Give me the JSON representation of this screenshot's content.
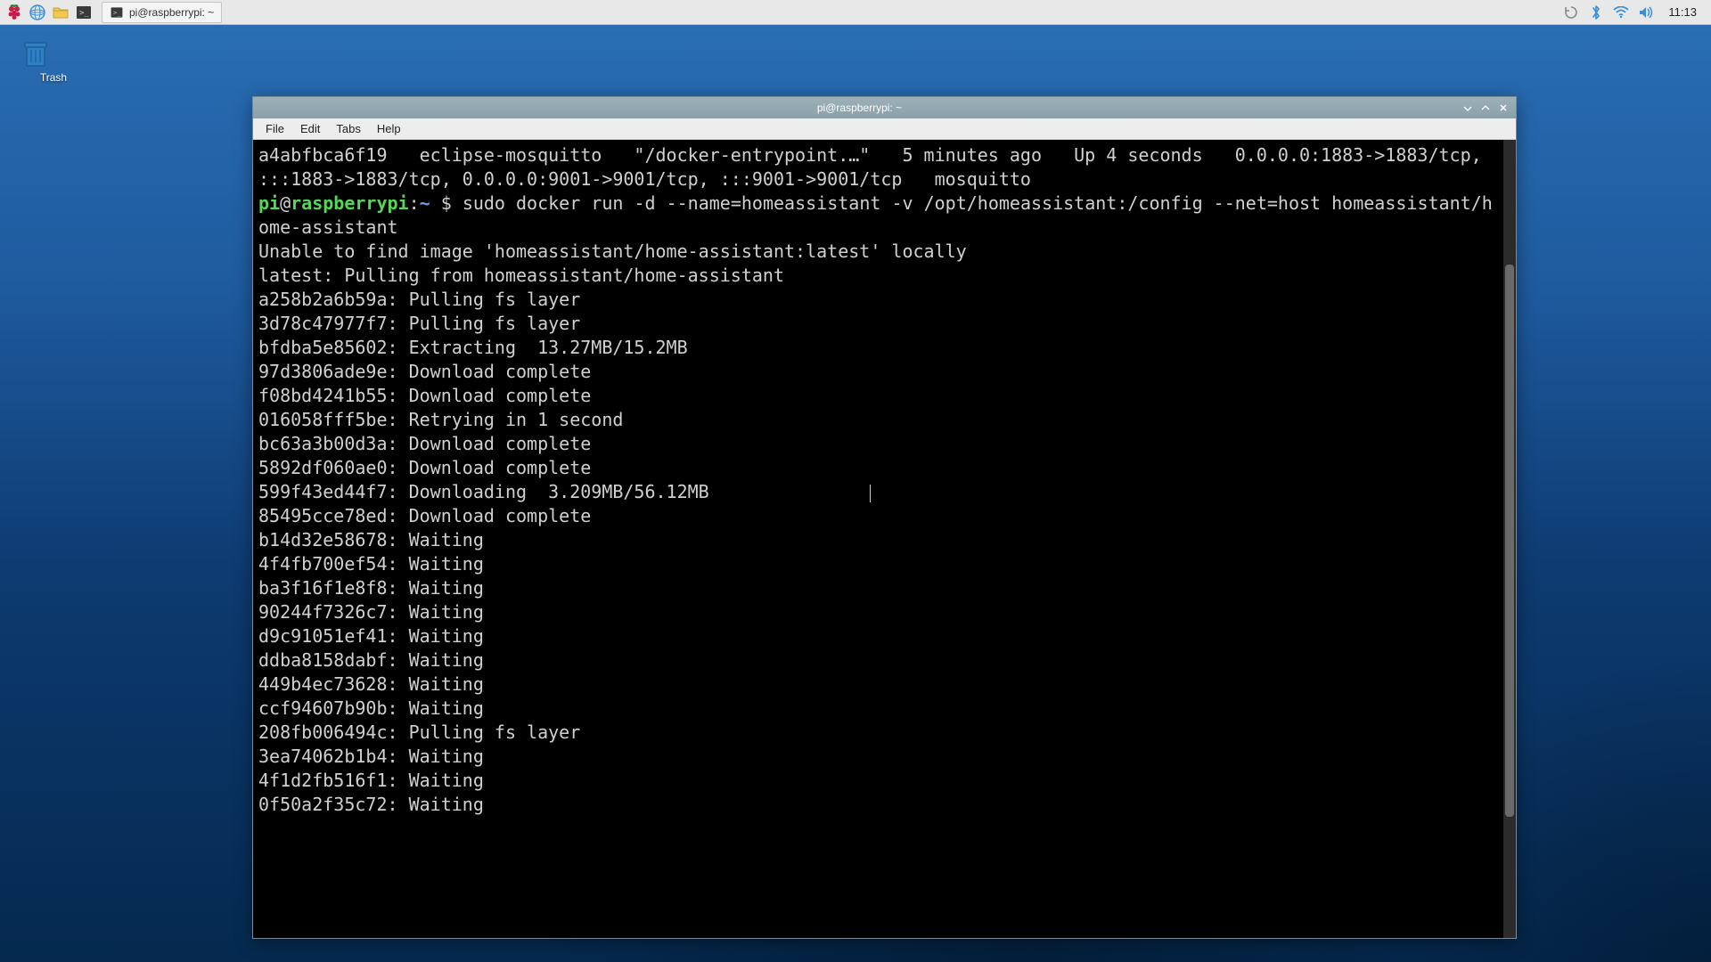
{
  "taskbar": {
    "task_title": "pi@raspberrypi: ~",
    "clock": "11:13"
  },
  "desktop": {
    "trash_label": "Trash"
  },
  "window": {
    "title": "pi@raspberrypi: ~",
    "menus": {
      "file": "File",
      "edit": "Edit",
      "tabs": "Tabs",
      "help": "Help"
    }
  },
  "prompt": {
    "user": "pi",
    "at": "@",
    "host": "raspberrypi",
    "colon": ":",
    "path": "~",
    "dollar": " $ ",
    "command": "sudo docker run -d --name=homeassistant -v /opt/homeassistant:/config --net=host homeassistant/home-assistant"
  },
  "term": {
    "prelude": "a4abfbca6f19   eclipse-mosquitto   \"/docker-entrypoint.…\"   5 minutes ago   Up 4 seconds   0.0.0.0:1883->1883/tcp, :::1883->1883/tcp, 0.0.0.0:9001->9001/tcp, :::9001->9001/tcp   mosquitto",
    "after": [
      "Unable to find image 'homeassistant/home-assistant:latest' locally",
      "latest: Pulling from homeassistant/home-assistant",
      "a258b2a6b59a: Pulling fs layer",
      "3d78c47977f7: Pulling fs layer",
      "bfdba5e85602: Extracting  13.27MB/15.2MB",
      "97d3806ade9e: Download complete",
      "f08bd4241b55: Download complete",
      "016058fff5be: Retrying in 1 second",
      "bc63a3b00d3a: Download complete",
      "5892df060ae0: Download complete",
      "599f43ed44f7: Downloading  3.209MB/56.12MB",
      "85495cce78ed: Download complete",
      "b14d32e58678: Waiting",
      "4f4fb700ef54: Waiting",
      "ba3f16f1e8f8: Waiting",
      "90244f7326c7: Waiting",
      "d9c91051ef41: Waiting",
      "ddba8158dabf: Waiting",
      "449b4ec73628: Waiting",
      "ccf94607b90b: Waiting",
      "208fb006494c: Pulling fs layer",
      "3ea74062b1b4: Waiting",
      "4f1d2fb516f1: Waiting",
      "0f50a2f35c72: Waiting"
    ]
  }
}
